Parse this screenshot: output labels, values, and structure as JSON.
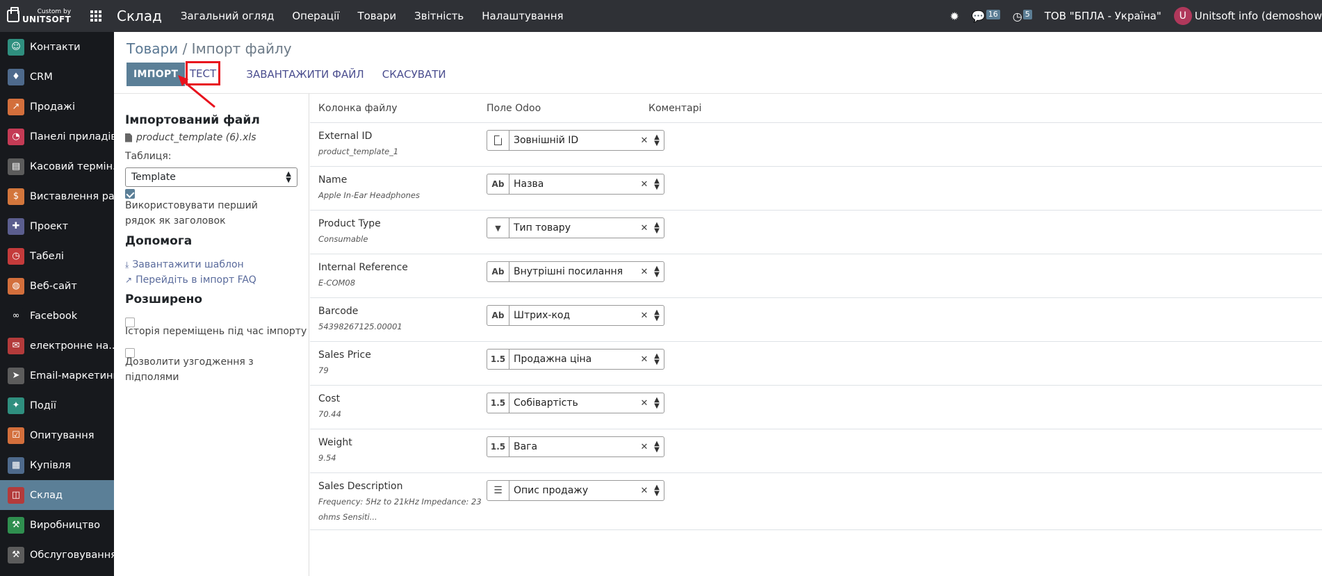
{
  "brand": {
    "small": "Custom by",
    "big": "UNITSOFT"
  },
  "topbar": {
    "app_title": "Склад",
    "menu": [
      "Загальний огляд",
      "Операції",
      "Товари",
      "Звітність",
      "Налаштування"
    ],
    "messages_count": "16",
    "activities_count": "5",
    "company": "ТОВ \"БПЛА - Україна\"",
    "avatar_letter": "U",
    "user": "Unitsoft info (demoshow"
  },
  "sidebar": {
    "items": [
      {
        "label": "Контакти",
        "icon": "contacts-icon",
        "color": "#2f8f7f",
        "glyph": "☺"
      },
      {
        "label": "CRM",
        "icon": "crm-handshake-icon",
        "color": "#4e6a8c",
        "glyph": "♦"
      },
      {
        "label": "Продажі",
        "icon": "sales-chart-icon",
        "color": "#d36f3c",
        "glyph": "↗"
      },
      {
        "label": "Панелі приладів",
        "icon": "dashboard-gauge-icon",
        "color": "#c43b55",
        "glyph": "◔"
      },
      {
        "label": "Касовий термін...",
        "icon": "pos-shop-icon",
        "color": "#5c5c5c",
        "glyph": "▤"
      },
      {
        "label": "Виставлення ра...",
        "icon": "invoice-icon",
        "color": "#d3763c",
        "glyph": "$"
      },
      {
        "label": "Проект",
        "icon": "project-puzzle-icon",
        "color": "#5b5e8f",
        "glyph": "✚"
      },
      {
        "label": "Табелі",
        "icon": "timesheet-clock-icon",
        "color": "#c43b3b",
        "glyph": "◷"
      },
      {
        "label": "Веб-сайт",
        "icon": "website-globe-icon",
        "color": "#d36f3c",
        "glyph": "◍"
      },
      {
        "label": "Facebook",
        "icon": "facebook-meta-icon",
        "color": "#17191d",
        "glyph": "∞"
      },
      {
        "label": "електронне на...",
        "icon": "email-marketing-icon",
        "color": "#b33b3b",
        "glyph": "✉"
      },
      {
        "label": "Email-маркетинг",
        "icon": "paper-plane-icon",
        "color": "#5c5c5c",
        "glyph": "➤"
      },
      {
        "label": "Події",
        "icon": "events-ticket-icon",
        "color": "#2f8f7f",
        "glyph": "✦"
      },
      {
        "label": "Опитування",
        "icon": "survey-icon",
        "color": "#d36f3c",
        "glyph": "☑"
      },
      {
        "label": "Купівля",
        "icon": "purchase-card-icon",
        "color": "#4e6a8c",
        "glyph": "▦"
      },
      {
        "label": "Склад",
        "icon": "inventory-box-icon",
        "color": "#b33b3b",
        "glyph": "◫",
        "active": true
      },
      {
        "label": "Виробництво",
        "icon": "manufacturing-wrench-icon",
        "color": "#2f8f4f",
        "glyph": "⚒"
      },
      {
        "label": "Обслуговування",
        "icon": "maintenance-hammer-icon",
        "color": "#5c5c5c",
        "glyph": "⚒"
      }
    ]
  },
  "breadcrumb": {
    "parent": "Товари",
    "separator": "/",
    "current": "Імпорт файлу"
  },
  "actions": {
    "import": "ІМПОРТ",
    "test": "ТЕСТ",
    "upload": "ЗАВАНТАЖИТИ ФАЙЛ",
    "cancel": "СКАСУВАТИ"
  },
  "options": {
    "imported_file_title": "Імпортований файл",
    "file_name": "product_template (6).xls",
    "sheet_label": "Таблиця:",
    "sheet_value": "Template",
    "use_header_label": "Використовувати перший рядок як заголовок",
    "help_title": "Допомога",
    "download_template": "Завантажити шаблон",
    "import_faq": "Перейдіть в імпорт FAQ",
    "advanced_title": "Розширено",
    "track_history": "Історія переміщень під час імпорту",
    "allow_subfields": "Дозволити узгодження з підполями"
  },
  "table": {
    "headers": {
      "column": "Колонка файлу",
      "field": "Поле Odoo",
      "comments": "Коментарі"
    },
    "rows": [
      {
        "name": "External ID",
        "sample": "product_template_1",
        "type": "file",
        "field": "Зовнішній ID"
      },
      {
        "name": "Name",
        "sample": "Apple In-Ear Headphones",
        "type": "Ab",
        "field": "Назва"
      },
      {
        "name": "Product Type",
        "sample": "Consumable",
        "type": "select",
        "field": "Тип товару"
      },
      {
        "name": "Internal Reference",
        "sample": "E-COM08",
        "type": "Ab",
        "field": "Внутрішні посилання"
      },
      {
        "name": "Barcode",
        "sample": "54398267125.00001",
        "type": "Ab",
        "field": "Штрих-код"
      },
      {
        "name": "Sales Price",
        "sample": "79",
        "type": "1.5",
        "field": "Продажна ціна"
      },
      {
        "name": "Cost",
        "sample": "70.44",
        "type": "1.5",
        "field": "Собівартість"
      },
      {
        "name": "Weight",
        "sample": "9.54",
        "type": "1.5",
        "field": "Вага"
      },
      {
        "name": "Sales Description",
        "sample": "Frequency: 5Hz to 21kHz Impedance: 23 ohms Sensiti...",
        "type": "text",
        "field": "Опис продажу"
      }
    ]
  }
}
